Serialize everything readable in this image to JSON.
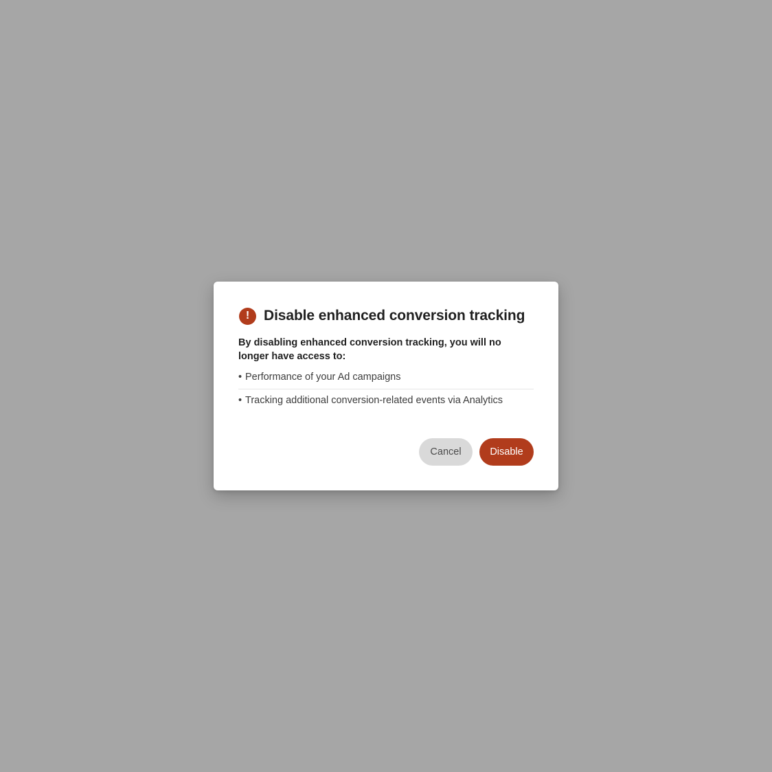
{
  "colors": {
    "backdrop": "#a6a6a6",
    "accent": "#b13c1c",
    "cancel_bg": "#d9d9d9"
  },
  "dialog": {
    "icon": "alert-exclamation-icon",
    "icon_glyph": "!",
    "title": "Disable enhanced conversion tracking",
    "description": "By disabling enhanced conversion tracking, you will no longer have access to:",
    "items": [
      {
        "bullet": "•",
        "label": "Performance of your Ad campaigns"
      },
      {
        "bullet": "•",
        "label": "Tracking additional conversion-related events via Analytics"
      }
    ],
    "buttons": {
      "cancel": "Cancel",
      "disable": "Disable"
    }
  }
}
